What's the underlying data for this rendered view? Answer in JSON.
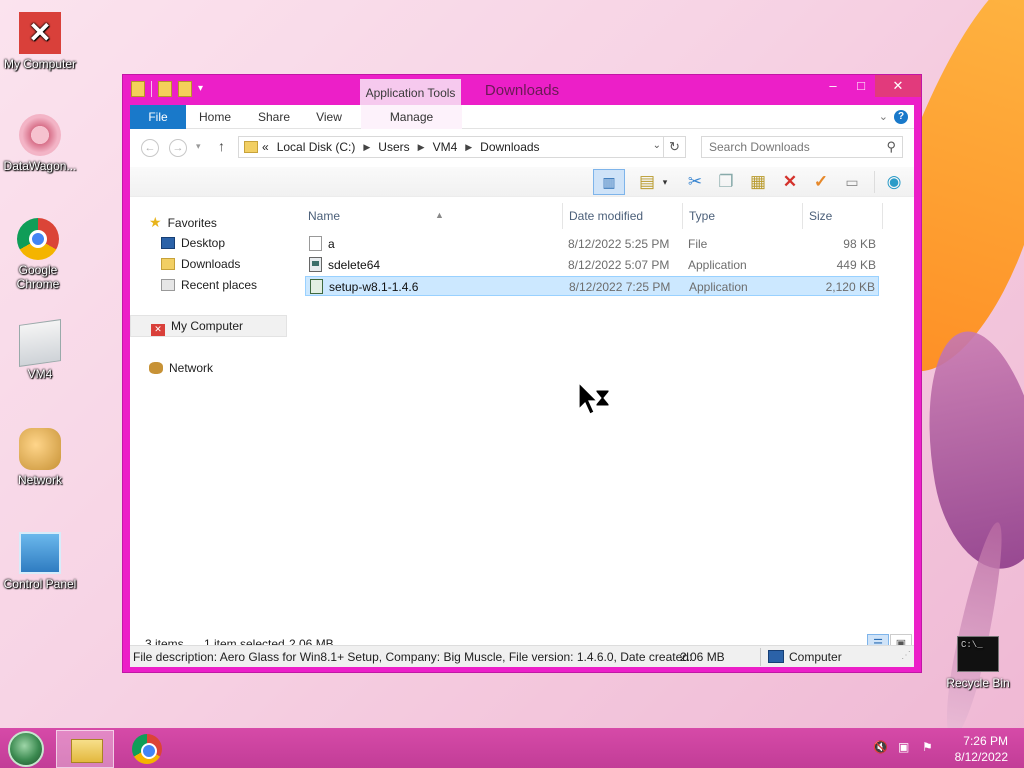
{
  "desktop": {
    "icons": [
      {
        "label": "My Computer",
        "icon": "my-computer-icon"
      },
      {
        "label": "DataWagon...",
        "icon": "datawagon-icon"
      },
      {
        "label": "Google Chrome",
        "icon": "chrome-icon"
      },
      {
        "label": "VM4",
        "icon": "user-folder-icon"
      },
      {
        "label": "Network",
        "icon": "network-icon"
      },
      {
        "label": "Control Panel",
        "icon": "control-panel-icon"
      }
    ],
    "recycle_bin": {
      "label": "Recycle Bin",
      "icon": "recycle-bin-icon",
      "screen_text": "C:\\_"
    }
  },
  "window": {
    "title": "Downloads",
    "contextual_tab": "Application Tools",
    "controls": {
      "minimize": "‒",
      "maximize": "□",
      "close": "✕"
    },
    "ribbon_tabs": {
      "file": "File",
      "home": "Home",
      "share": "Share",
      "view": "View",
      "manage": "Manage"
    },
    "address": {
      "overflow": "«",
      "crumbs": [
        "Local Disk (C:)",
        "Users",
        "VM4",
        "Downloads"
      ]
    },
    "search": {
      "placeholder": "Search Downloads"
    },
    "sidebar": {
      "favorites": "Favorites",
      "desktop": "Desktop",
      "downloads": "Downloads",
      "recent": "Recent places",
      "my_computer": "My Computer",
      "network": "Network"
    },
    "columns": {
      "name": "Name",
      "date": "Date modified",
      "type": "Type",
      "size": "Size"
    },
    "files": [
      {
        "name": "a",
        "date": "8/12/2022 5:25 PM",
        "type": "File",
        "size": "98 KB",
        "icon": "file-icon",
        "selected": false
      },
      {
        "name": "sdelete64",
        "date": "8/12/2022 5:07 PM",
        "type": "Application",
        "size": "449 KB",
        "icon": "application-icon",
        "selected": false
      },
      {
        "name": "setup-w8.1-1.4.6",
        "date": "8/12/2022 7:25 PM",
        "type": "Application",
        "size": "2,120 KB",
        "icon": "setup-icon",
        "selected": true
      }
    ],
    "status": {
      "items": "3 items",
      "selected": "1 item selected",
      "selected_size": "2.06 MB"
    },
    "details_bar": {
      "description": "File description: Aero Glass for Win8.1+ Setup, Company: Big Muscle, File version: 1.4.6.0, Date created:",
      "size": "2.06 MB",
      "location": "Computer"
    }
  },
  "taskbar": {
    "time": "7:26 PM",
    "date": "8/12/2022"
  },
  "colors": {
    "window_frame": "#ec1fc8",
    "selection": "#cce8ff",
    "file_tab": "#1979ca",
    "taskbar": "#c23d97"
  }
}
